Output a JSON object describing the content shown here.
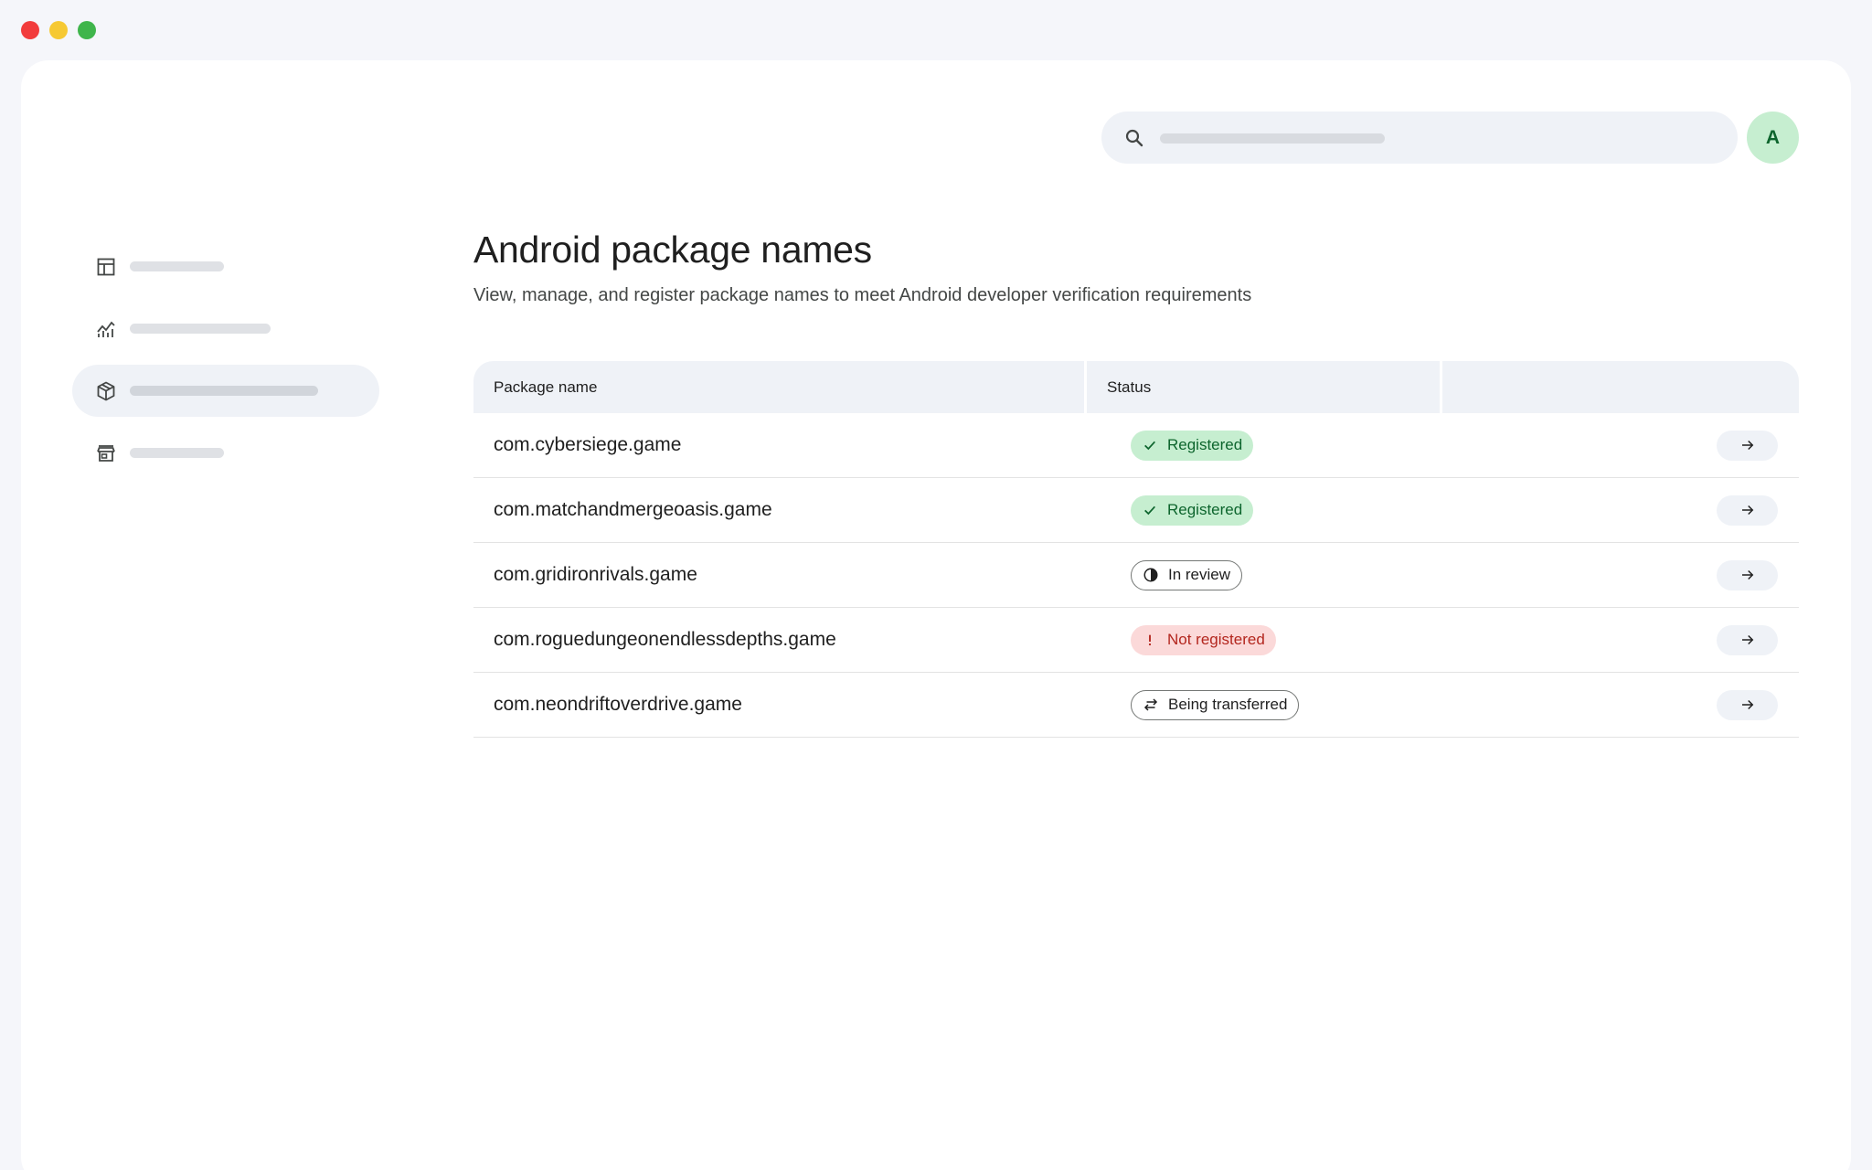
{
  "window_controls": [
    "close",
    "minimize",
    "maximize"
  ],
  "header": {
    "search": {
      "icon": "search-icon"
    },
    "avatar_initial": "A"
  },
  "sidebar": {
    "items": [
      {
        "icon": "dashboard-icon",
        "active": false
      },
      {
        "icon": "analytics-icon",
        "active": false
      },
      {
        "icon": "package-icon",
        "active": true
      },
      {
        "icon": "store-icon",
        "active": false
      }
    ]
  },
  "main": {
    "title": "Android package names",
    "subtitle": "View, manage, and register package names to meet Android developer verification requirements",
    "table": {
      "columns": [
        "Package name",
        "Status",
        ""
      ],
      "rows": [
        {
          "package": "com.cybersiege.game",
          "status": "Registered",
          "status_type": "registered",
          "status_icon": "check-icon"
        },
        {
          "package": "com.matchandmergeoasis.game",
          "status": "Registered",
          "status_type": "registered",
          "status_icon": "check-icon"
        },
        {
          "package": "com.gridironrivals.game",
          "status": "In review",
          "status_type": "review",
          "status_icon": "half-circle-icon"
        },
        {
          "package": "com.roguedungeonendlessdepths.game",
          "status": "Not registered",
          "status_type": "notreg",
          "status_icon": "exclamation-icon"
        },
        {
          "package": "com.neondriftoverdrive.game",
          "status": "Being transferred",
          "status_type": "transfer",
          "status_icon": "swap-arrows-icon"
        }
      ]
    }
  },
  "colors": {
    "registered_bg": "#c6eed0",
    "registered_text": "#0d652d",
    "not_registered_bg": "#fbd9d9",
    "not_registered_text": "#b3261e",
    "surface": "#eff2f7"
  }
}
